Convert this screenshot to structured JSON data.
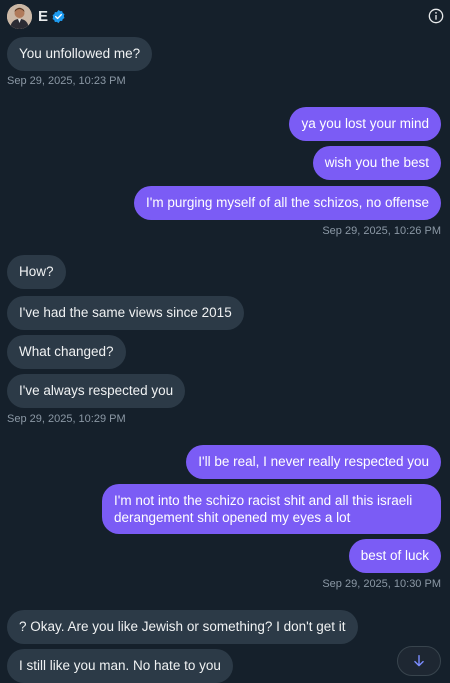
{
  "header": {
    "name": "E",
    "verified_icon": "verified-badge-icon",
    "info_icon": "info-icon"
  },
  "colors": {
    "background": "#15202b",
    "incoming_bubble": "#2c3a47",
    "outgoing_bubble": "#7b5cf5",
    "verified": "#1d9bf0",
    "timestamp": "#8b98a5"
  },
  "groups": [
    {
      "direction": "incoming",
      "messages": [
        "You unfollowed me?"
      ],
      "timestamp": "Sep 29, 2025, 10:23 PM"
    },
    {
      "direction": "outgoing",
      "messages": [
        "ya you lost your mind",
        "wish you the best",
        "I'm purging myself of all the schizos, no offense"
      ],
      "timestamp": "Sep 29, 2025, 10:26 PM"
    },
    {
      "direction": "incoming",
      "messages": [
        "How?",
        "I've had the same views since 2015",
        "What changed?",
        "I've always respected you"
      ],
      "timestamp": "Sep 29, 2025, 10:29 PM"
    },
    {
      "direction": "outgoing",
      "messages": [
        "I'll be real, I never really respected you",
        "I'm not into the schizo racist shit and all this israeli derangement shit opened my eyes a lot",
        "best of luck"
      ],
      "timestamp": "Sep 29, 2025, 10:30 PM"
    },
    {
      "direction": "incoming",
      "messages": [
        "? Okay. Are you like Jewish or something? I don't get it",
        "I still like you man. No hate to you"
      ]
    }
  ],
  "scroll_button": {
    "icon": "arrow-down-icon"
  }
}
